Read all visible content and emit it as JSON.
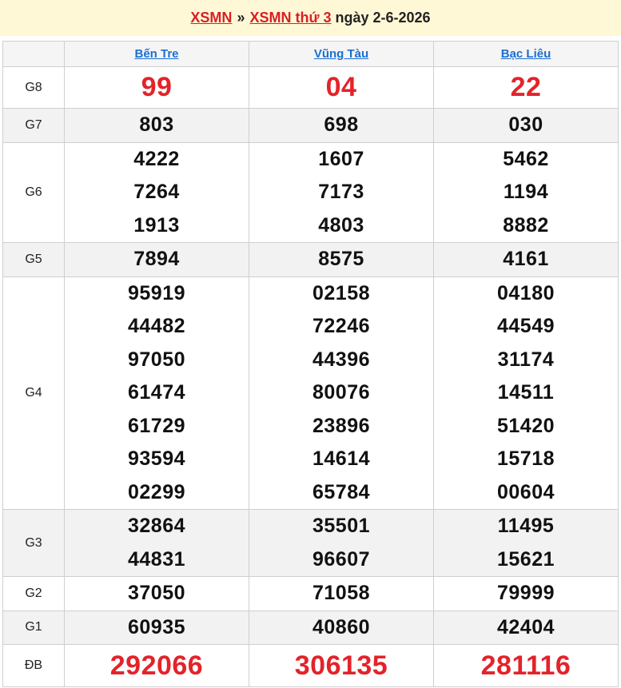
{
  "header": {
    "link1": "XSMN",
    "separator": "»",
    "link2": "XSMN thứ 3",
    "date_text": "ngày 2-6-2026"
  },
  "provinces": [
    "Bến Tre",
    "Vũng Tàu",
    "Bạc Liêu"
  ],
  "prizes": [
    {
      "label": "G8",
      "style": "big-red",
      "alt": false,
      "values": [
        [
          "99"
        ],
        [
          "04"
        ],
        [
          "22"
        ]
      ]
    },
    {
      "label": "G7",
      "style": "normal",
      "alt": true,
      "values": [
        [
          "803"
        ],
        [
          "698"
        ],
        [
          "030"
        ]
      ]
    },
    {
      "label": "G6",
      "style": "normal",
      "alt": false,
      "values": [
        [
          "4222",
          "7264",
          "1913"
        ],
        [
          "1607",
          "7173",
          "4803"
        ],
        [
          "5462",
          "1194",
          "8882"
        ]
      ]
    },
    {
      "label": "G5",
      "style": "normal",
      "alt": true,
      "values": [
        [
          "7894"
        ],
        [
          "8575"
        ],
        [
          "4161"
        ]
      ]
    },
    {
      "label": "G4",
      "style": "normal",
      "alt": false,
      "values": [
        [
          "95919",
          "44482",
          "97050",
          "61474",
          "61729",
          "93594",
          "02299"
        ],
        [
          "02158",
          "72246",
          "44396",
          "80076",
          "23896",
          "14614",
          "65784"
        ],
        [
          "04180",
          "44549",
          "31174",
          "14511",
          "51420",
          "15718",
          "00604"
        ]
      ]
    },
    {
      "label": "G3",
      "style": "normal",
      "alt": true,
      "values": [
        [
          "32864",
          "44831"
        ],
        [
          "35501",
          "96607"
        ],
        [
          "11495",
          "15621"
        ]
      ]
    },
    {
      "label": "G2",
      "style": "normal",
      "alt": false,
      "values": [
        [
          "37050"
        ],
        [
          "71058"
        ],
        [
          "79999"
        ]
      ]
    },
    {
      "label": "G1",
      "style": "normal",
      "alt": true,
      "values": [
        [
          "60935"
        ],
        [
          "40860"
        ],
        [
          "42404"
        ]
      ]
    },
    {
      "label": "ĐB",
      "style": "db-red",
      "alt": false,
      "values": [
        [
          "292066"
        ],
        [
          "306135"
        ],
        [
          "281116"
        ]
      ]
    }
  ],
  "colors": {
    "header_bg": "#fff8d6",
    "accent_red": "#e3232a",
    "link_blue": "#1a6fd1",
    "alt_row_bg": "#f2f2f2"
  }
}
